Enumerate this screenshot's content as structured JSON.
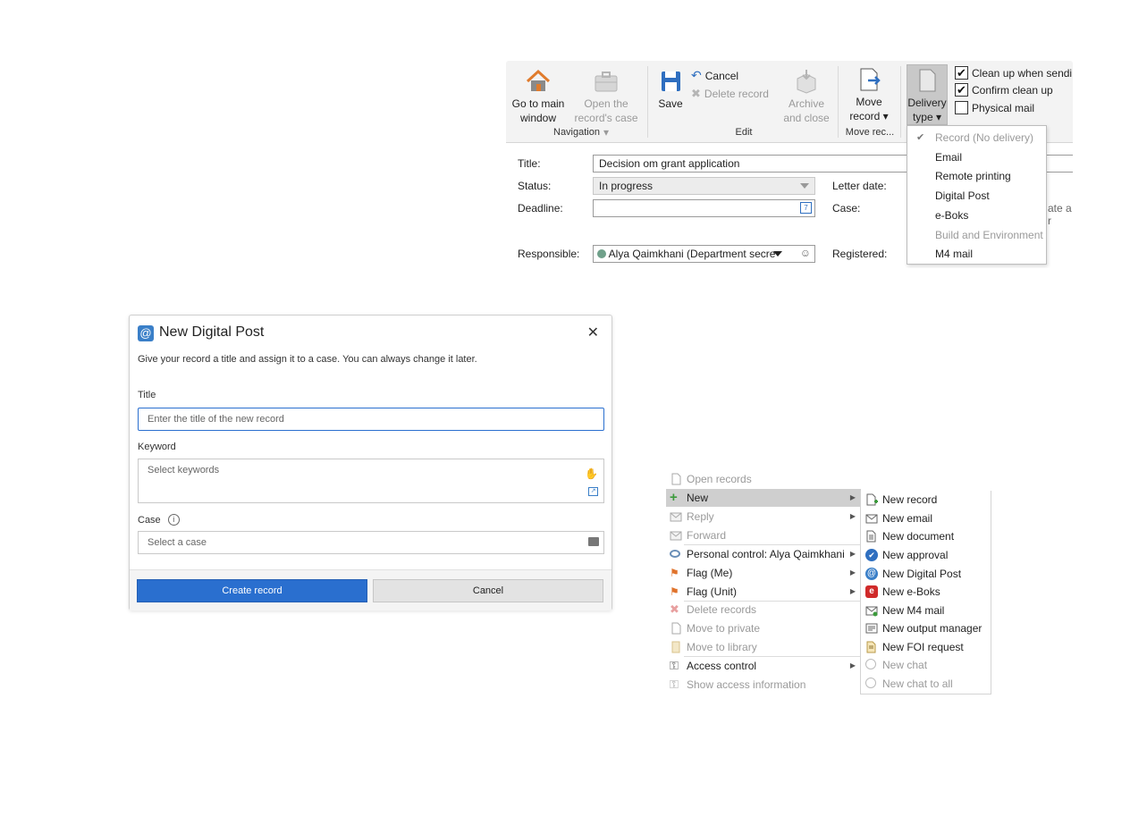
{
  "ribbon": {
    "navigation": {
      "group_label": "Navigation",
      "go_main_line1": "Go to main",
      "go_main_line2": "window",
      "open_case_line1": "Open the",
      "open_case_line2": "record's case ▾"
    },
    "edit": {
      "group_label": "Edit",
      "save": "Save",
      "cancel": "Cancel",
      "delete": "Delete record",
      "archive_line1": "Archive",
      "archive_line2": "and close"
    },
    "move": {
      "group_label": "Move rec...",
      "move_line1": "Move",
      "move_line2": "record ▾"
    },
    "delivery": {
      "label_line1": "Delivery",
      "label_line2": "type ▾"
    },
    "checkboxes": [
      {
        "label": "Clean up when sendi",
        "checked": true
      },
      {
        "label": "Confirm clean up",
        "checked": true
      },
      {
        "label": "Physical mail",
        "checked": false
      }
    ]
  },
  "record_form": {
    "title_label": "Title:",
    "title_value": "Decision om grant application",
    "status_label": "Status:",
    "status_value": "In progress",
    "deadline_label": "Deadline:",
    "responsible_label": "Responsible:",
    "responsible_value": "Alya Qaimkhani (Department secre",
    "letter_date_label": "Letter date:",
    "case_label": "Case:",
    "case_partial": "ate a r",
    "registered_label": "Registered:"
  },
  "delivery_dropdown": {
    "items": [
      {
        "label": "Record (No delivery)",
        "checked": true,
        "disabled": true
      },
      {
        "label": "Email",
        "checked": false,
        "disabled": false
      },
      {
        "label": "Remote printing",
        "checked": false,
        "disabled": false
      },
      {
        "label": "Digital Post",
        "checked": false,
        "disabled": false
      },
      {
        "label": "e-Boks",
        "checked": false,
        "disabled": false
      },
      {
        "label": "Build and Environment",
        "checked": false,
        "disabled": true
      },
      {
        "label": "M4 mail",
        "checked": false,
        "disabled": false
      }
    ]
  },
  "dialog": {
    "title": "New Digital Post",
    "close_glyph": "✕",
    "subtitle": "Give your record a title and assign it to a case. You can always change it later.",
    "title_field_label": "Title",
    "title_placeholder": "Enter the title of the new record",
    "keyword_label": "Keyword",
    "keyword_placeholder": "Select keywords",
    "case_label": "Case",
    "case_placeholder": "Select a case",
    "create_button": "Create record",
    "cancel_button": "Cancel"
  },
  "context_menu": {
    "items": [
      {
        "label": "Open records",
        "disabled": true,
        "submenu": false,
        "icon": "document-icon"
      },
      {
        "label": "New",
        "disabled": false,
        "submenu": true,
        "icon": "plus-icon",
        "highlighted": true
      },
      {
        "label": "Reply",
        "disabled": true,
        "submenu": true,
        "icon": "reply-icon"
      },
      {
        "label": "Forward",
        "disabled": true,
        "submenu": false,
        "icon": "forward-icon"
      },
      {
        "label": "Personal control: Alya Qaimkhani",
        "disabled": false,
        "submenu": true,
        "icon": "eye-icon"
      },
      {
        "label": "Flag (Me)",
        "disabled": false,
        "submenu": true,
        "icon": "flag-icon"
      },
      {
        "label": "Flag (Unit)",
        "disabled": false,
        "submenu": true,
        "icon": "flag-icon"
      },
      {
        "label": "Delete records",
        "disabled": true,
        "submenu": false,
        "icon": "delete-icon"
      },
      {
        "label": "Move to private",
        "disabled": true,
        "submenu": false,
        "icon": "private-icon"
      },
      {
        "label": "Move to library",
        "disabled": true,
        "submenu": false,
        "icon": "library-icon"
      },
      {
        "label": "Access control",
        "disabled": false,
        "submenu": true,
        "icon": "key-icon"
      },
      {
        "label": "Show access information",
        "disabled": true,
        "submenu": false,
        "icon": "key-icon"
      }
    ]
  },
  "new_submenu": {
    "items": [
      {
        "label": "New record",
        "disabled": false,
        "icon": "new-record-icon"
      },
      {
        "label": "New email",
        "disabled": false,
        "icon": "email-icon"
      },
      {
        "label": "New document",
        "disabled": false,
        "icon": "document-icon"
      },
      {
        "label": "New approval",
        "disabled": false,
        "icon": "approval-icon"
      },
      {
        "label": "New Digital Post",
        "disabled": false,
        "icon": "digital-post-icon"
      },
      {
        "label": "New e-Boks",
        "disabled": false,
        "icon": "eboks-icon"
      },
      {
        "label": "New M4 mail",
        "disabled": false,
        "icon": "m4-mail-icon"
      },
      {
        "label": "New output manager",
        "disabled": false,
        "icon": "output-manager-icon"
      },
      {
        "label": "New FOI request",
        "disabled": false,
        "icon": "foi-icon"
      },
      {
        "label": "New chat",
        "disabled": true,
        "icon": "chat-icon"
      },
      {
        "label": "New chat to all",
        "disabled": true,
        "icon": "chat-icon"
      }
    ]
  },
  "colors": {
    "primary_button": "#2a6fcf",
    "menu_highlight": "#cfcfcf",
    "disabled_text": "#9a9a9a",
    "eboks_red": "#d02a2a",
    "approval_blue": "#2f6fc0"
  }
}
